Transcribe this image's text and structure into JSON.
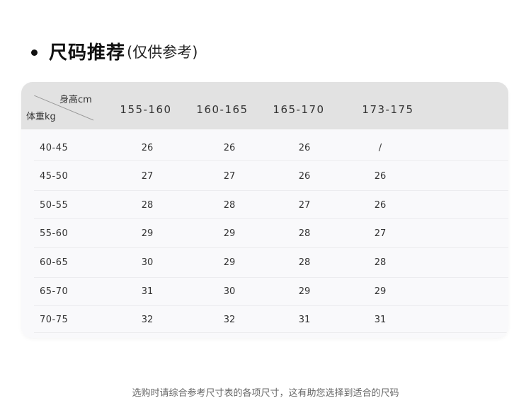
{
  "title": {
    "main": "尺码推荐",
    "sub": "(仅供参考)"
  },
  "table": {
    "corner_top": "身高cm",
    "corner_bottom": "体重kg",
    "height_headers": [
      "155-160",
      "160-165",
      "165-170",
      "173-175"
    ],
    "rows": [
      {
        "weight": "40-45",
        "values": [
          "26",
          "26",
          "26",
          "/"
        ]
      },
      {
        "weight": "45-50",
        "values": [
          "27",
          "27",
          "26",
          "26"
        ]
      },
      {
        "weight": "50-55",
        "values": [
          "28",
          "28",
          "27",
          "26"
        ]
      },
      {
        "weight": "55-60",
        "values": [
          "29",
          "29",
          "28",
          "27"
        ]
      },
      {
        "weight": "60-65",
        "values": [
          "30",
          "29",
          "28",
          "28"
        ]
      },
      {
        "weight": "65-70",
        "values": [
          "31",
          "30",
          "29",
          "29"
        ]
      },
      {
        "weight": "70-75",
        "values": [
          "32",
          "32",
          "31",
          "31"
        ]
      }
    ]
  },
  "footer": {
    "note": "选购时请综合参考尺寸表的各项尺寸，这有助您选择到适合的尺码"
  }
}
